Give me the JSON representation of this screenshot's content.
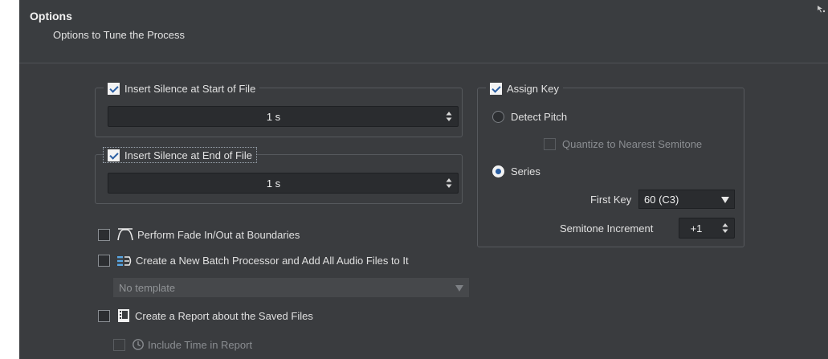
{
  "header": {
    "title": "Options",
    "subtitle": "Options to Tune the Process"
  },
  "silence_start": {
    "label": "Insert Silence at Start of File",
    "checked": true,
    "value": "1 s"
  },
  "silence_end": {
    "label": "Insert Silence at End of File",
    "checked": true,
    "value": "1 s"
  },
  "fade": {
    "label": "Perform Fade In/Out at Boundaries",
    "checked": false,
    "icon": "fade-icon"
  },
  "batch": {
    "label": "Create a New Batch Processor and Add All Audio Files to It",
    "checked": false,
    "icon": "batch-processor-icon",
    "template_value": "No template"
  },
  "report": {
    "label": "Create a Report about the Saved Files",
    "checked": false,
    "icon": "report-icon"
  },
  "report_time": {
    "label": "Include Time in Report",
    "checked": false,
    "icon": "clock-icon"
  },
  "assign_key": {
    "label": "Assign Key",
    "checked": true,
    "detect_pitch_label": "Detect Pitch",
    "quantize_label": "Quantize to Nearest Semitone",
    "series_label": "Series",
    "selected_mode": "Series",
    "first_key_label": "First Key",
    "first_key_value": "60 (C3)",
    "semitone_label": "Semitone Increment",
    "semitone_value": "+1"
  },
  "colors": {
    "panel_bg": "#3a3c3f",
    "field_bg": "#2a2c2f",
    "accent": "#2b5fa3"
  }
}
